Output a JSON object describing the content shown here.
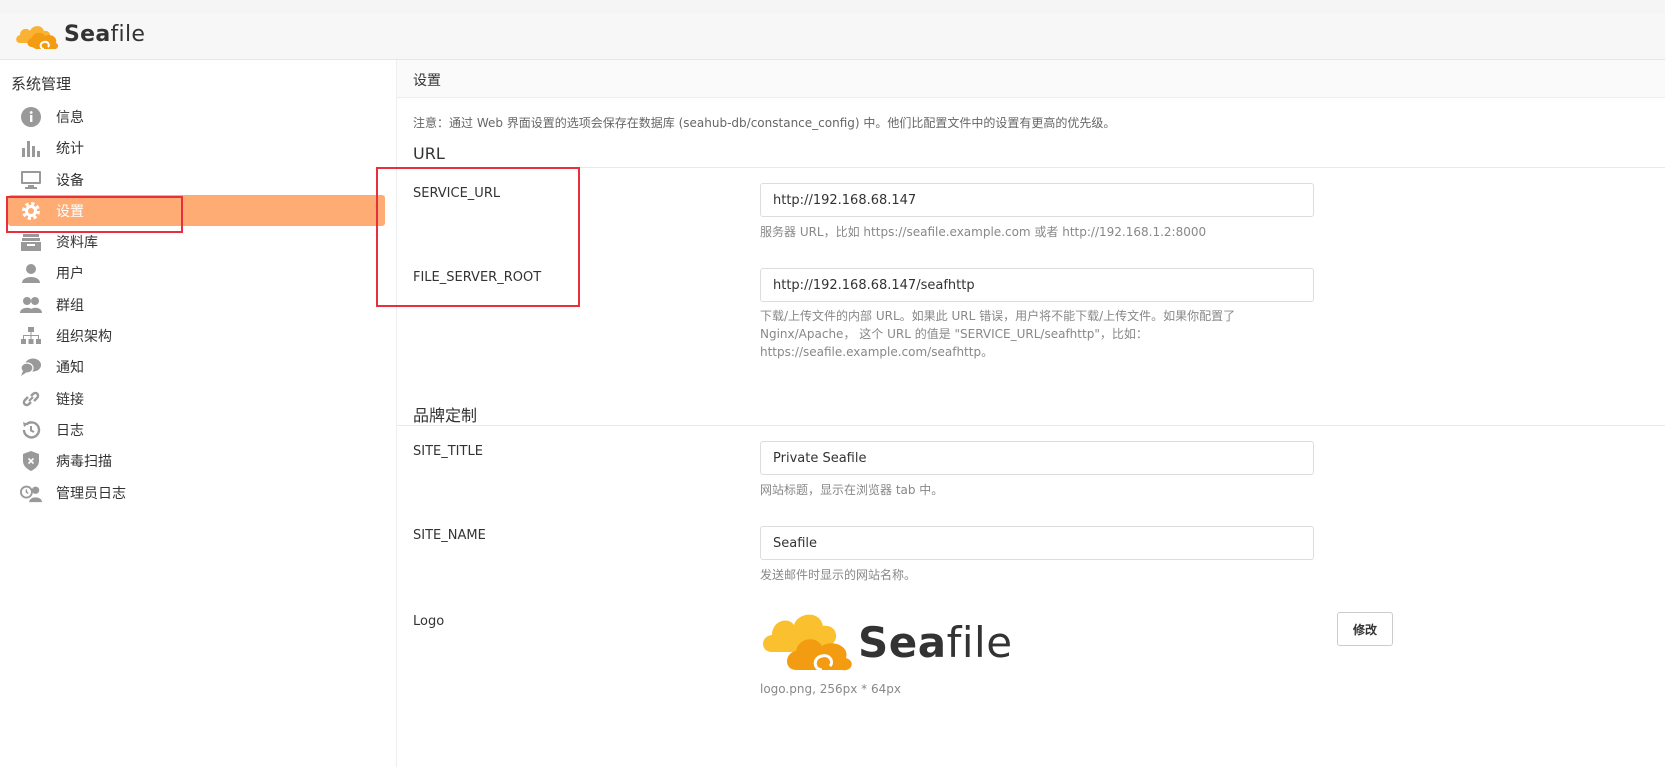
{
  "app": {
    "brand_bold": "Sea",
    "brand_rest": "file"
  },
  "sidebar": {
    "title": "系统管理",
    "items": [
      {
        "label": "信息",
        "icon": "info-icon"
      },
      {
        "label": "统计",
        "icon": "bar-chart-icon"
      },
      {
        "label": "设备",
        "icon": "monitor-icon"
      },
      {
        "label": "设置",
        "icon": "gear-icon",
        "active": true
      },
      {
        "label": "资料库",
        "icon": "library-icon"
      },
      {
        "label": "用户",
        "icon": "user-icon"
      },
      {
        "label": "群组",
        "icon": "group-icon"
      },
      {
        "label": "组织架构",
        "icon": "org-chart-icon"
      },
      {
        "label": "通知",
        "icon": "chat-icon"
      },
      {
        "label": "链接",
        "icon": "link-icon"
      },
      {
        "label": "日志",
        "icon": "history-icon"
      },
      {
        "label": "病毒扫描",
        "icon": "shield-icon"
      },
      {
        "label": "管理员日志",
        "icon": "admin-log-icon"
      }
    ]
  },
  "main": {
    "title": "设置",
    "notice": "注意：通过 Web 界面设置的选项会保存在数据库 (seahub-db/constance_config) 中。他们比配置文件中的设置有更高的优先级。",
    "sections": {
      "url": "URL",
      "branding": "品牌定制"
    },
    "fields": {
      "service_url": {
        "label": "SERVICE_URL",
        "value": "http://192.168.68.147",
        "help": "服务器 URL，比如 https://seafile.example.com 或者 http://192.168.1.2:8000"
      },
      "file_server_root": {
        "label": "FILE_SERVER_ROOT",
        "value": "http://192.168.68.147/seafhttp",
        "help": "下载/上传文件的内部 URL。如果此 URL 错误，用户将不能下载/上传文件。如果你配置了 Nginx/Apache， 这个 URL 的值是 \"SERVICE_URL/seafhttp\"，比如：https://seafile.example.com/seafhttp。"
      },
      "site_title": {
        "label": "SITE_TITLE",
        "value": "Private Seafile",
        "help": "网站标题，显示在浏览器 tab 中。"
      },
      "site_name": {
        "label": "SITE_NAME",
        "value": "Seafile",
        "help": "发送邮件时显示的网站名称。"
      },
      "logo": {
        "label": "Logo",
        "help": "logo.png, 256px * 64px",
        "button": "修改"
      }
    }
  },
  "colors": {
    "accent": "#feac74",
    "highlight": "#e8303a",
    "logo_orange": "#f5a623",
    "logo_yellow": "#fbc02d"
  }
}
